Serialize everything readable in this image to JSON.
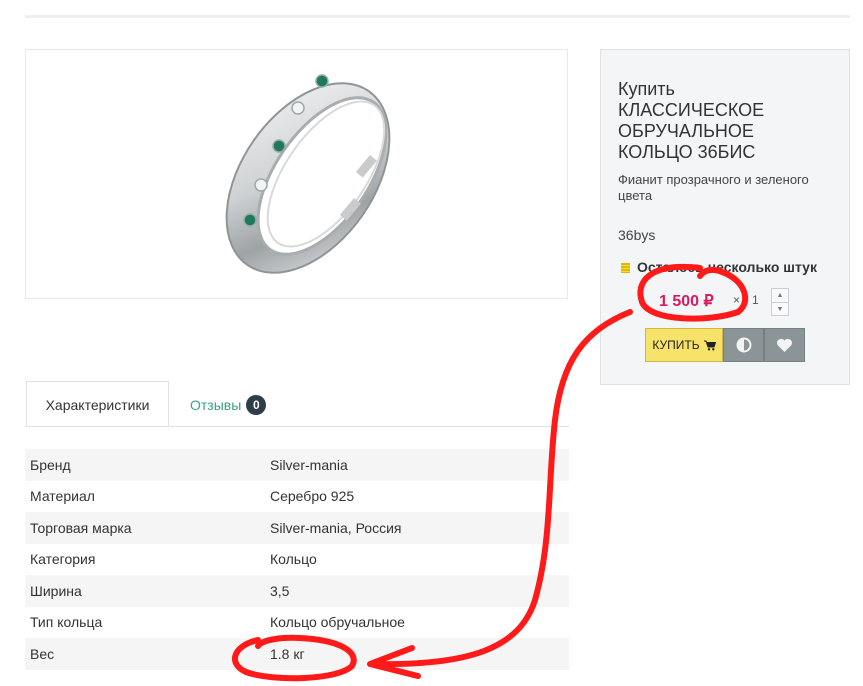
{
  "product": {
    "image_alt": "Классическое обручальное кольцо 36бис",
    "buy_title": "Купить КЛАССИЧЕСКОЕ ОБРУЧАЛЬНОЕ КОЛЬЦО 36БИС",
    "description": "Фианит прозрачного и зеленого цвета",
    "sku": "36bys",
    "stock_text": "Осталось несколько штук",
    "price": "1 500 ₽",
    "times_sign": "×",
    "quantity": "1",
    "buy_button_label": "КУПИТЬ"
  },
  "icons": {
    "cart": "cart-icon",
    "compare": "compare-icon",
    "favorite": "heart-icon",
    "stock": "stock-level-icon"
  },
  "tabs": [
    {
      "label": "Характеристики",
      "active": true
    },
    {
      "label": "Отзывы",
      "badge": "0",
      "active": false
    }
  ],
  "specs": [
    {
      "name": "Бренд",
      "value": "Silver-mania"
    },
    {
      "name": "Материал",
      "value": "Серебро 925"
    },
    {
      "name": "Торговая марка",
      "value": "Silver-mania, Россия"
    },
    {
      "name": "Категория",
      "value": "Кольцо"
    },
    {
      "name": "Ширина",
      "value": "3,5"
    },
    {
      "name": "Тип кольца",
      "value": "Кольцо обручальное"
    },
    {
      "name": "Вес",
      "value": "1.8 кг"
    }
  ],
  "colors": {
    "price": "#d81b60",
    "buy_button": "#f8e36a",
    "secondary_button": "#8b9597",
    "reviews_tab": "#3aa37e",
    "annotation": "#ff0000"
  }
}
